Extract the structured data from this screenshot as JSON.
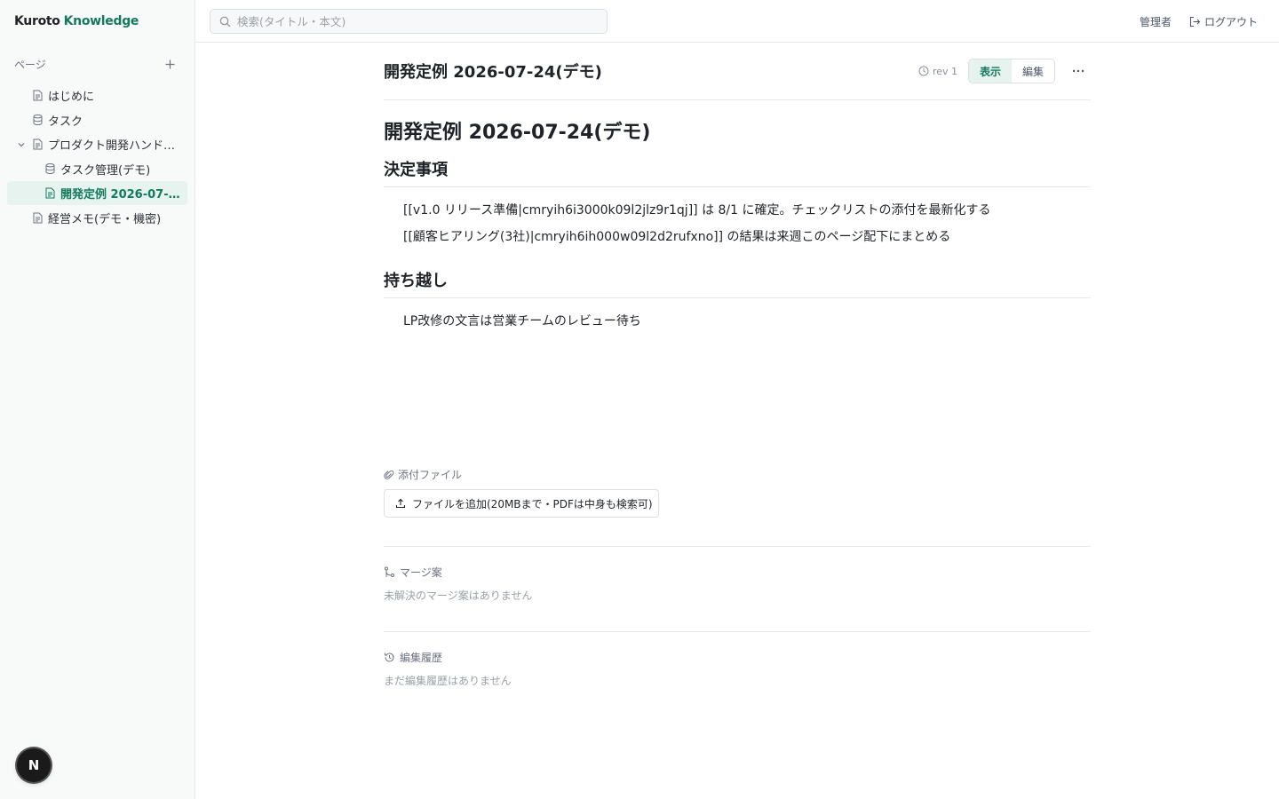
{
  "brand": {
    "part1": "Kuroto",
    "part2": "Knowledge"
  },
  "sidebar": {
    "section_label": "ページ",
    "items": [
      {
        "label": "はじめに",
        "icon": "page-icon"
      },
      {
        "label": "タスク",
        "icon": "database-icon"
      },
      {
        "label": "プロダクト開発ハンド…",
        "icon": "page-icon",
        "expanded": true
      },
      {
        "label": "タスク管理(デモ)",
        "icon": "database-icon"
      },
      {
        "label": "開発定例 2026-07-2…",
        "icon": "page-icon",
        "active": true
      },
      {
        "label": "経営メモ(デモ・機密)",
        "icon": "page-icon"
      }
    ],
    "badge": "N"
  },
  "topbar": {
    "search_placeholder": "検索(タイトル・本文)",
    "user": "管理者",
    "logout": "ログアウト"
  },
  "page": {
    "title": "開発定例 2026-07-24(デモ)",
    "rev": "rev 1",
    "view_label": "表示",
    "edit_label": "編集",
    "active_mode": "view"
  },
  "doc": {
    "h1": "開発定例 2026-07-24(デモ)",
    "sections": [
      {
        "heading": "決定事項",
        "paragraphs": [
          "[[v1.0 リリース準備|cmryih6i3000k09l2jlz9r1qj]] は 8/1 に確定。チェックリストの添付を最新化する",
          "[[顧客ヒアリング(3社)|cmryih6ih000w09l2d2rufxno]] の結果は来週このページ配下にまとめる"
        ]
      },
      {
        "heading": "持ち越し",
        "paragraphs": [
          "LP改修の文言は営業チームのレビュー待ち"
        ]
      }
    ]
  },
  "attachments": {
    "label": "添付ファイル",
    "upload_label": "ファイルを追加(20MBまで・PDFは中身も検索可)"
  },
  "merge": {
    "label": "マージ案",
    "empty": "未解決のマージ案はありません"
  },
  "history": {
    "label": "編集履歴",
    "empty": "まだ編集履歴はありません"
  },
  "colors": {
    "accent": "#147a5c",
    "accent_bg": "#e6f3ee"
  }
}
